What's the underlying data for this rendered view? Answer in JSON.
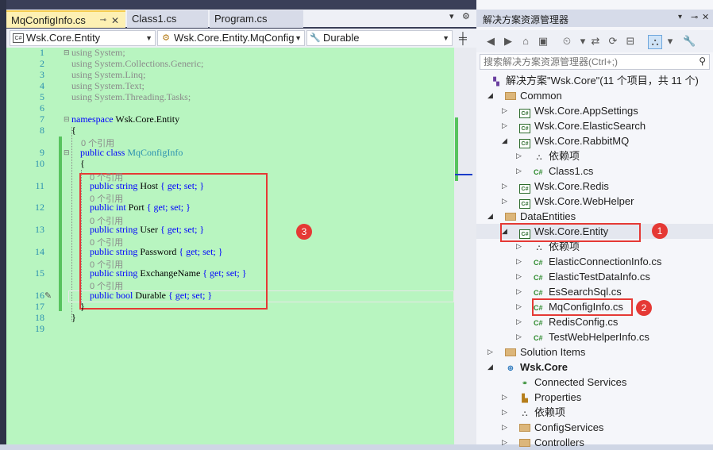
{
  "editor": {
    "tabs": [
      {
        "label": "MqConfigInfo.cs",
        "active": true
      },
      {
        "label": "Class1.cs",
        "active": false
      },
      {
        "label": "Program.cs",
        "active": false
      }
    ],
    "nav": {
      "project": "Wsk.Core.Entity",
      "type": "Wsk.Core.Entity.MqConfig",
      "member": "Durable"
    },
    "line_numbers": [
      "1",
      "2",
      "3",
      "4",
      "5",
      "6",
      "7",
      "8",
      "9",
      "10",
      "11",
      "12",
      "13",
      "14",
      "15",
      "16",
      "17",
      "18",
      "19"
    ],
    "code": {
      "l1_kw": "using",
      "l1_rest": " System;",
      "l2_kw": "using",
      "l2_rest": " System.Collections.Generic;",
      "l3_kw": "using",
      "l3_rest": " System.Linq;",
      "l4_kw": "using",
      "l4_rest": " System.Text;",
      "l5_kw": "using",
      "l5_rest": " System.Threading.Tasks;",
      "l7_kw": "namespace",
      "l7_rest": " Wsk.Core.Entity",
      "open_brace": "{",
      "close_brace": "}",
      "refs": "0 个引用",
      "l9_kw": "public class",
      "l9_type": " MqConfigInfo",
      "props": [
        {
          "kw": "public string",
          "name": " Host ",
          "acc": "{ get; set; }"
        },
        {
          "kw": "public int",
          "name": " Port ",
          "acc": "{ get; set; }"
        },
        {
          "kw": "public string",
          "name": " User ",
          "acc": "{ get; set; }"
        },
        {
          "kw": "public string",
          "name": " Password ",
          "acc": "{ get; set; }"
        },
        {
          "kw": "public string",
          "name": " ExchangeName ",
          "acc": "{ get; set; }"
        },
        {
          "kw": "public bool",
          "name": " Durable ",
          "acc": "{ get; set; }"
        }
      ]
    },
    "badge3": "3"
  },
  "solution_explorer": {
    "title": "解决方案资源管理器",
    "search_placeholder": "搜索解决方案资源管理器(Ctrl+;)",
    "solution": "解决方案\"Wsk.Core\"(11 个项目，共 11 个)",
    "items": {
      "common": "Common",
      "appsettings": "Wsk.Core.AppSettings",
      "elasticsearch": "Wsk.Core.ElasticSearch",
      "rabbitmq": "Wsk.Core.RabbitMQ",
      "deps1": "依赖项",
      "class1": "Class1.cs",
      "redis": "Wsk.Core.Redis",
      "webhelper": "Wsk.Core.WebHelper",
      "dataentities": "DataEntities",
      "entity": "Wsk.Core.Entity",
      "deps2": "依赖项",
      "elasticconn": "ElasticConnectionInfo.cs",
      "elastictest": "ElasticTestDataInfo.cs",
      "essearch": "EsSearchSql.cs",
      "mqconfig": "MqConfigInfo.cs",
      "redisconfig": "RedisConfig.cs",
      "testweb": "TestWebHelperInfo.cs",
      "solutionitems": "Solution Items",
      "wskcore": "Wsk.Core",
      "connected": "Connected Services",
      "properties": "Properties",
      "deps3": "依赖项",
      "configservices": "ConfigServices",
      "controllers": "Controllers"
    },
    "badge1": "1",
    "badge2": "2"
  }
}
